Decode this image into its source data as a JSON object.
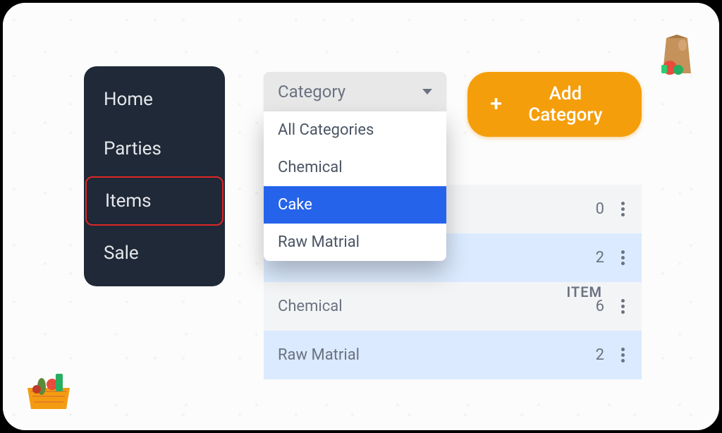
{
  "sidebar": {
    "items": [
      {
        "label": "Home",
        "active": false
      },
      {
        "label": "Parties",
        "active": false
      },
      {
        "label": "Items",
        "active": true
      },
      {
        "label": "Sale",
        "active": false
      }
    ]
  },
  "dropdown": {
    "label": "Category",
    "options": [
      {
        "label": "All Categories",
        "selected": false
      },
      {
        "label": "Chemical",
        "selected": false
      },
      {
        "label": "Cake",
        "selected": true
      },
      {
        "label": "Raw Matrial",
        "selected": false
      }
    ]
  },
  "addButton": {
    "label": "Add Category"
  },
  "table": {
    "header": "ITEM",
    "rows": [
      {
        "name": "",
        "count": "0",
        "bg": "light-gray"
      },
      {
        "name": "",
        "count": "2",
        "bg": "light-blue"
      },
      {
        "name": "Chemical",
        "count": "6",
        "bg": "light-gray"
      },
      {
        "name": "Raw Matrial",
        "count": "2",
        "bg": "light-blue"
      }
    ]
  }
}
